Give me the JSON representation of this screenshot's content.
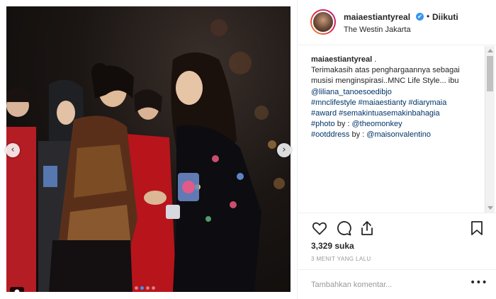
{
  "post": {
    "username": "maiaestiantyreal",
    "verified_glyph": "✔",
    "separator": "•",
    "follow_label": "Diikuti",
    "location": "The Westin Jakarta",
    "caption": {
      "username": "maiaestiantyreal",
      "username_suffix": " .",
      "line1": "Terimakasih atas penghargaannya sebagai",
      "line2": "musisi menginspirasi..MNC Life Style... ibu",
      "mention1": "@liliana_tanoesoedibjo",
      "line4": "#mnclifestyle #maiaestianty #diarymaia",
      "line5": "#award #semakintuasemakinbahagia",
      "photo_label": "#photo",
      "photo_by": " by : ",
      "photo_mention": "@theomonkey",
      "ootd_label": "#ootddress",
      "ootd_by": " by : ",
      "ootd_mention": "@maisonvalentino"
    },
    "likes": "3,329 suka",
    "time_ago": "3 MENIT YANG LALU",
    "comment_placeholder": "Tambahkan komentar...",
    "more_glyph": "•••"
  },
  "carousel": {
    "prev_glyph": "‹",
    "next_glyph": "›",
    "slide_count": 4,
    "active_slide": 2
  },
  "colors": {
    "accent": "#3897f0",
    "link": "#003569",
    "border": "#efefef",
    "muted": "#999999"
  },
  "icons": {
    "like": "heart-icon",
    "comment": "comment-icon",
    "share": "share-icon",
    "save": "bookmark-icon",
    "tag": "user-tag-icon",
    "verified": "verified-badge-icon"
  }
}
